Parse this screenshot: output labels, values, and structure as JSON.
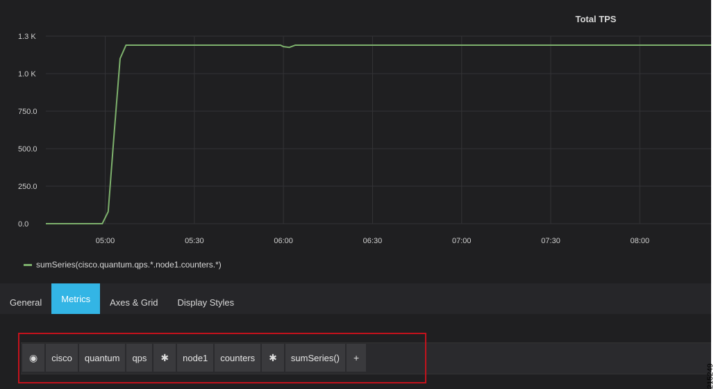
{
  "chart_data": {
    "type": "line",
    "title": "Total TPS",
    "y_ticks": [
      "0.0",
      "250.0",
      "500.0",
      "750.0",
      "1.0 K",
      "1.3 K"
    ],
    "y_tick_values": [
      0,
      250,
      500,
      750,
      1000,
      1250
    ],
    "x_ticks": [
      "05:00",
      "05:30",
      "06:00",
      "06:30",
      "07:00",
      "07:30",
      "08:00"
    ],
    "x_tick_minutes": [
      300,
      330,
      360,
      390,
      420,
      450,
      480
    ],
    "xlim_minutes": [
      280,
      504
    ],
    "ylim": [
      0,
      1250
    ],
    "grid": true,
    "legend_position": "bottom-left",
    "series": [
      {
        "name": "sumSeries(cisco.quantum.qps.*.node1.counters.*)",
        "color": "#7eb26d",
        "x_minutes": [
          280,
          290,
          299,
          301,
          303,
          305,
          307,
          310,
          320,
          359,
          360,
          362,
          364,
          366,
          380,
          504
        ],
        "values": [
          0,
          0,
          0,
          80,
          600,
          1100,
          1190,
          1190,
          1190,
          1190,
          1180,
          1175,
          1190,
          1190,
          1190,
          1190
        ]
      }
    ]
  },
  "legend": {
    "label": "sumSeries(cisco.quantum.qps.*.node1.counters.*)"
  },
  "tabs": [
    {
      "label": "General",
      "active": false
    },
    {
      "label": "Metrics",
      "active": true
    },
    {
      "label": "Axes & Grid",
      "active": false
    },
    {
      "label": "Display Styles",
      "active": false
    }
  ],
  "query": {
    "segments": [
      {
        "label": "◉",
        "icon": "eye-icon",
        "kind": "icon"
      },
      {
        "label": "cisco",
        "kind": "text"
      },
      {
        "label": "quantum",
        "kind": "text"
      },
      {
        "label": "qps",
        "kind": "text"
      },
      {
        "label": "✱",
        "icon": "wildcard-icon",
        "kind": "icon"
      },
      {
        "label": "node1",
        "kind": "text"
      },
      {
        "label": "counters",
        "kind": "text"
      },
      {
        "label": "✱",
        "icon": "wildcard-icon",
        "kind": "icon"
      },
      {
        "label": "sumSeries()",
        "kind": "text"
      },
      {
        "label": "+",
        "icon": "plus-icon",
        "kind": "icon"
      }
    ]
  },
  "figure_id": "215249",
  "colors": {
    "background": "#1f1f21",
    "series": "#7eb26d",
    "active_tab": "#33b5e5",
    "highlight": "#c4121c"
  }
}
